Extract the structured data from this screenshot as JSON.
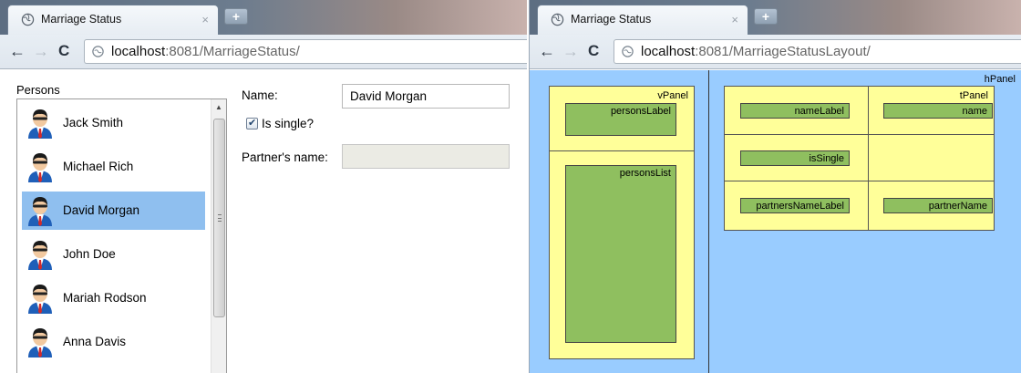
{
  "left_window": {
    "tab_title": "Marriage Status",
    "tab_close": "×",
    "new_tab": "+",
    "url_host": "localhost",
    "url_rest": ":8081/MarriageStatus/",
    "persons_label": "Persons",
    "persons": [
      {
        "name": "Jack Smith",
        "selected": false
      },
      {
        "name": "Michael Rich",
        "selected": false
      },
      {
        "name": "David Morgan",
        "selected": true
      },
      {
        "name": "John Doe",
        "selected": false
      },
      {
        "name": "Mariah Rodson",
        "selected": false
      },
      {
        "name": "Anna Davis",
        "selected": false
      }
    ],
    "name_label": "Name:",
    "name_value": "David Morgan",
    "is_single_label": "Is single?",
    "is_single_checked": true,
    "partner_label": "Partner's name:",
    "partner_value": ""
  },
  "right_window": {
    "tab_title": "Marriage Status",
    "tab_close": "×",
    "new_tab": "+",
    "url_host": "localhost",
    "url_rest": ":8081/MarriageStatusLayout/",
    "layout": {
      "hPanel": "hPanel",
      "vPanel": "vPanel",
      "tPanel": "tPanel",
      "personsLabel": "personsLabel",
      "personsList": "personsList",
      "nameLabel": "nameLabel",
      "name": "name",
      "isSingle": "isSingle",
      "partnersNameLabel": "partnersNameLabel",
      "partnerName": "partnerName"
    }
  },
  "colors": {
    "selection": "#8fbfef",
    "layout_background": "#99ccff",
    "panel_yellow": "#ffff99",
    "widget_green": "#8fbf5f"
  },
  "icons": [
    "globe-icon",
    "back-arrow-icon",
    "forward-arrow-icon",
    "reload-icon",
    "page-icon",
    "person-avatar-icon",
    "checkbox-icon",
    "scroll-up-icon",
    "scroll-down-icon"
  ]
}
